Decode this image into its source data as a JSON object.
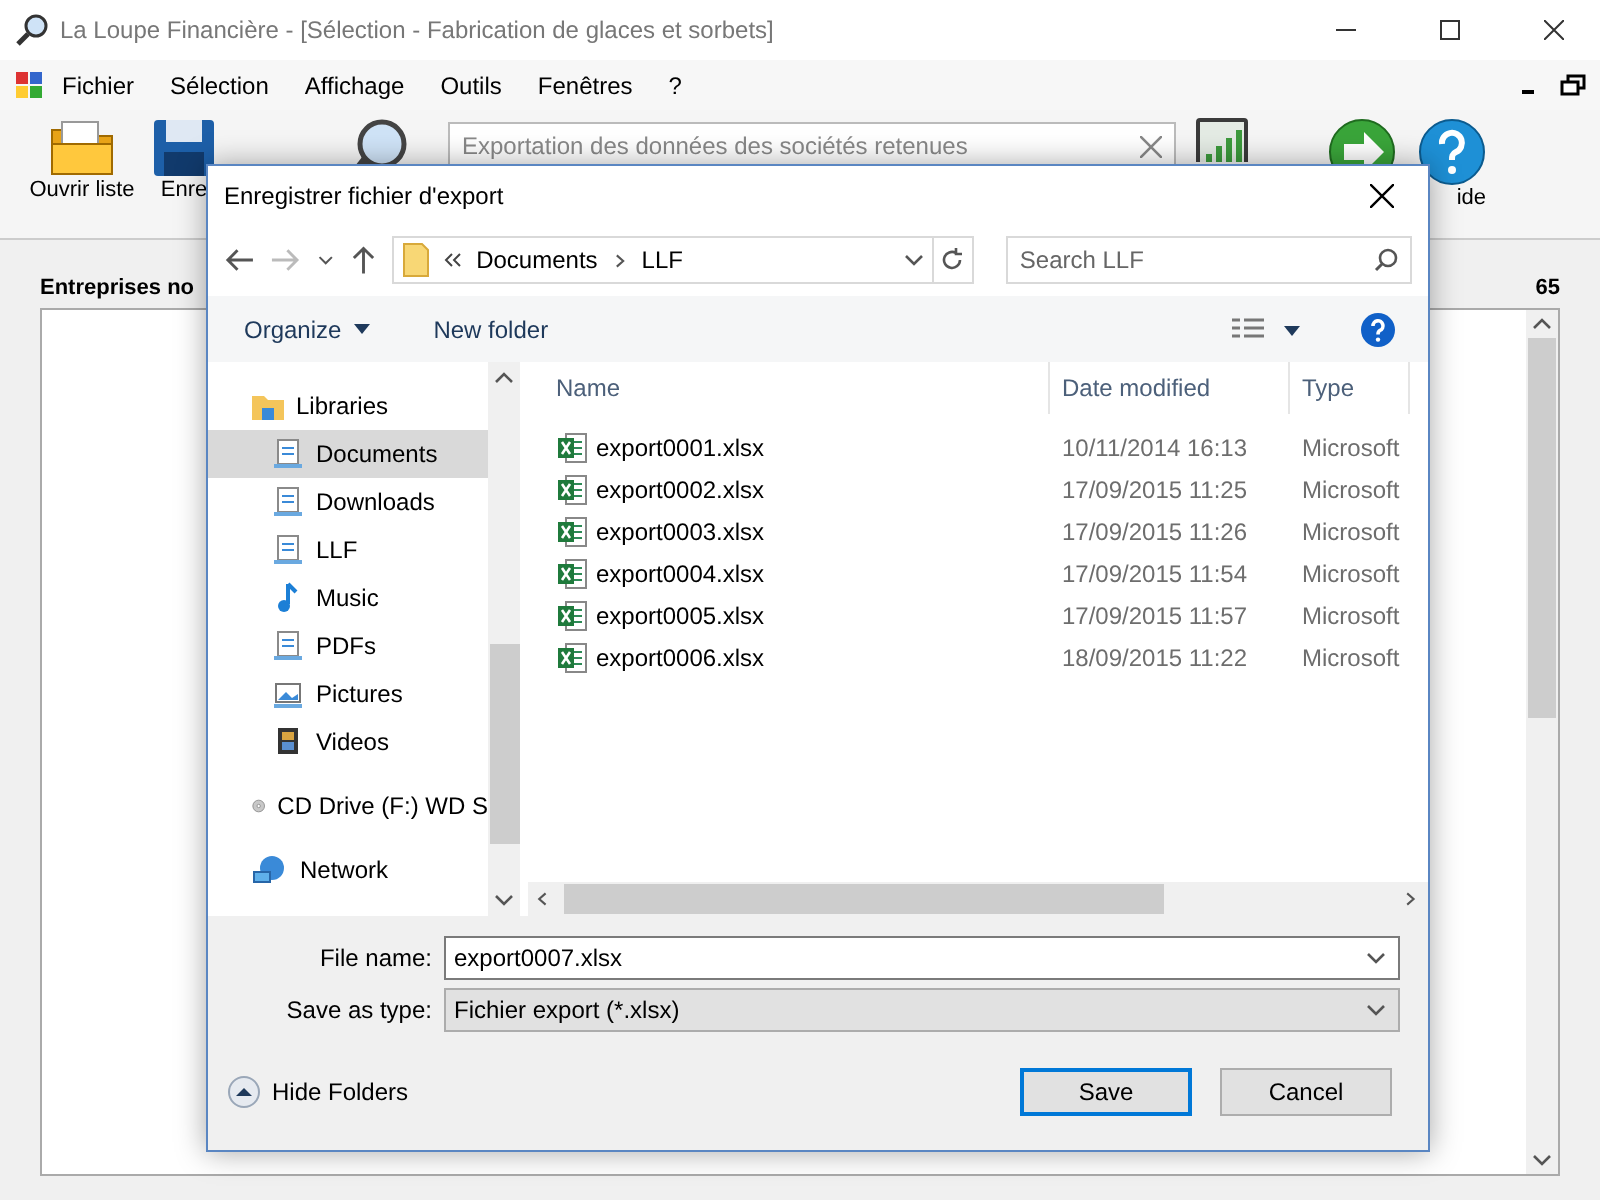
{
  "window": {
    "title": "La Loupe Financière - [Sélection - Fabrication de glaces et sorbets]"
  },
  "menu": [
    "Fichier",
    "Sélection",
    "Affichage",
    "Outils",
    "Fenêtres",
    "?"
  ],
  "toolbar": [
    {
      "kind": "open",
      "label": "Ouvrir liste"
    },
    {
      "kind": "save",
      "label": "Enre"
    },
    {
      "kind": "search"
    },
    {
      "kind": "field",
      "placeholder": "Exportation des données des sociétés retenues"
    },
    {
      "kind": "chart"
    },
    {
      "kind": "next"
    },
    {
      "kind": "help",
      "label": "ide"
    }
  ],
  "panel": {
    "title": "Entreprises no",
    "count": "65"
  },
  "dialog": {
    "title": "Enregistrer fichier d'export",
    "path": [
      "Documents",
      "LLF"
    ],
    "search": {
      "placeholder": "Search LLF"
    },
    "commands": {
      "organize": "Organize",
      "new_folder": "New folder"
    },
    "nav": [
      {
        "label": "Libraries",
        "kind": "library",
        "selected": false,
        "children": [
          {
            "label": "Documents",
            "kind": "document",
            "selected": true
          },
          {
            "label": "Downloads",
            "kind": "document",
            "selected": false
          },
          {
            "label": "LLF",
            "kind": "document",
            "selected": false
          },
          {
            "label": "Music",
            "kind": "music",
            "selected": false
          },
          {
            "label": "PDFs",
            "kind": "document",
            "selected": false
          },
          {
            "label": "Pictures",
            "kind": "pictures",
            "selected": false
          },
          {
            "label": "Videos",
            "kind": "videos",
            "selected": false
          }
        ]
      },
      {
        "label": "CD Drive (F:) WD S",
        "kind": "drive",
        "selected": false
      },
      {
        "label": "Network",
        "kind": "network",
        "selected": false
      }
    ],
    "columns": [
      "Name",
      "Date modified",
      "Type"
    ],
    "files": [
      {
        "name": "export0001.xlsx",
        "date": "10/11/2014 16:13",
        "type": "Microsoft"
      },
      {
        "name": "export0002.xlsx",
        "date": "17/09/2015 11:25",
        "type": "Microsoft"
      },
      {
        "name": "export0003.xlsx",
        "date": "17/09/2015 11:26",
        "type": "Microsoft"
      },
      {
        "name": "export0004.xlsx",
        "date": "17/09/2015 11:54",
        "type": "Microsoft"
      },
      {
        "name": "export0005.xlsx",
        "date": "17/09/2015 11:57",
        "type": "Microsoft"
      },
      {
        "name": "export0006.xlsx",
        "date": "18/09/2015 11:22",
        "type": "Microsoft"
      }
    ],
    "file_name": {
      "label": "File name:",
      "value": "export0007.xlsx"
    },
    "save_type": {
      "label": "Save as type:",
      "value": "Fichier export (*.xlsx)"
    },
    "hide_folders": "Hide Folders",
    "buttons": [
      "Save",
      "Cancel"
    ]
  }
}
